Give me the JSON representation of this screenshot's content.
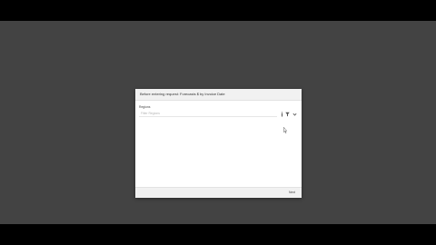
{
  "dialog": {
    "title": "Before entering request: Forecasts $ by Invoice Date",
    "field_label": "Regions",
    "field_placeholder": "Filter Regions",
    "next_label": "Next"
  },
  "icons": {
    "info": "info-icon",
    "filter": "filter-icon",
    "expand": "chevron-down-icon",
    "cursor": "mouse-cursor-icon"
  },
  "colors": {
    "screen_background": "#434343",
    "letterbox": "#000000",
    "dialog_background": "#ffffff",
    "dialog_chrome": "#f1f1f1"
  }
}
